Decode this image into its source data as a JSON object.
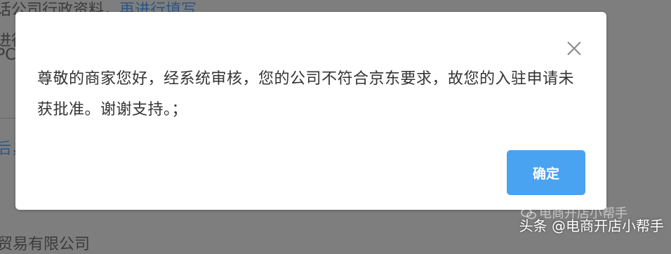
{
  "background": {
    "line1_prefix": "话公司行政资料，",
    "line1_suffix": "再进行填写",
    "line2": "进行",
    "line3": "PC",
    "line4": "后，",
    "line5": "贸易有限公司"
  },
  "dialog": {
    "message": "尊敬的商家您好，经系统审核，您的公司不符合京东要求，故您的入驻申请未获批准。谢谢支持。；",
    "confirm_label": "确定",
    "close_icon": "close-icon"
  },
  "watermark": {
    "text": "头条 @电商开店小帮手",
    "ghost_text": "电商开店小帮手",
    "ghost_icon": "wechat-icon"
  },
  "colors": {
    "overlay": "#7e7e7e",
    "dialog_bg": "#ffffff",
    "confirm_button": "#4aa3f0",
    "message_text": "#333333"
  }
}
